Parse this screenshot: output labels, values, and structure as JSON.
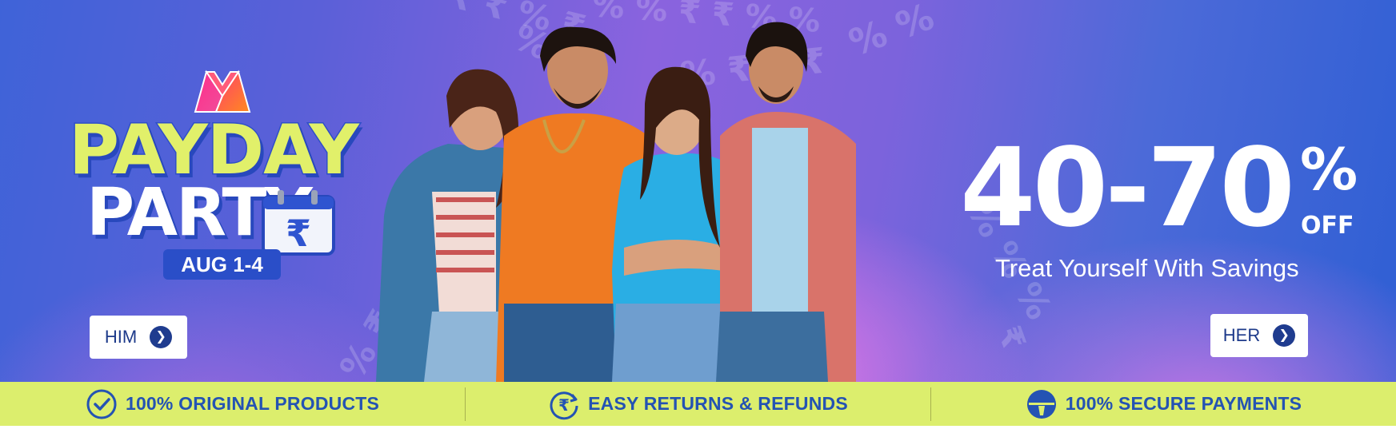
{
  "banner": {
    "brand_icon": "myntra-m-logo",
    "event": {
      "line1": "PAYDAY",
      "line2": "PARTY",
      "dates": "AUG 1-4",
      "calendar_icon": "rupee-calendar-icon"
    },
    "offer": {
      "range": "40-70",
      "percent": "%",
      "off": "OFF",
      "tagline": "Treat Yourself With Savings"
    },
    "ctas": [
      {
        "label": "HIM",
        "icon": "chevron-right-icon"
      },
      {
        "label": "HER",
        "icon": "chevron-right-icon"
      }
    ]
  },
  "trust_strip": [
    {
      "icon": "check-circle-icon",
      "label": "100% ORIGINAL PRODUCTS"
    },
    {
      "icon": "rupee-refresh-icon",
      "label": "EASY RETURNS & REFUNDS"
    },
    {
      "icon": "lock-icon",
      "label": "100% SECURE PAYMENTS"
    }
  ],
  "colors": {
    "banner_blue": "#3f63d8",
    "banner_purple": "#8a63de",
    "banner_pink": "#ea7fe6",
    "headline_yellow": "#e1f06a",
    "strip_green": "#dcee6d",
    "strip_text": "#2453b3",
    "cta_text": "#1d3a8a"
  }
}
